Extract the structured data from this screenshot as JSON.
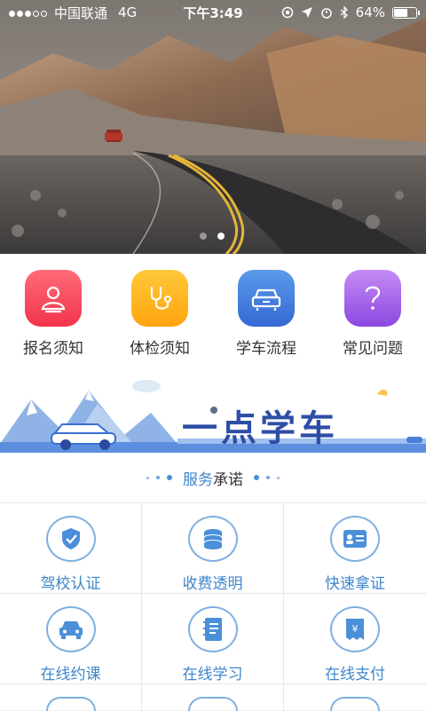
{
  "status_bar": {
    "carrier": "中国联通",
    "network": "4G",
    "time": "下午3:49",
    "battery": "64%",
    "battery_level": 0.64
  },
  "hero": {
    "slide_count": 2,
    "active_slide": 2
  },
  "quick_links": [
    {
      "label": "报名须知",
      "icon": "user-icon",
      "color_from": "#ff6b7a",
      "color_to": "#f2344b"
    },
    {
      "label": "体检须知",
      "icon": "stethoscope-icon",
      "color_from": "#ffc93a",
      "color_to": "#ffa40f"
    },
    {
      "label": "学车流程",
      "icon": "car-icon",
      "color_from": "#5a9bea",
      "color_to": "#3568d4"
    },
    {
      "label": "常见问题",
      "icon": "question-icon",
      "color_from": "#c58cf5",
      "color_to": "#8d47e0"
    }
  ],
  "banner": {
    "title": "一点学车"
  },
  "promise": {
    "title_blue": "服务",
    "title_dark": "承诺"
  },
  "services": [
    {
      "label": "驾校认证",
      "icon": "shield-check-icon"
    },
    {
      "label": "收费透明",
      "icon": "coins-icon"
    },
    {
      "label": "快速拿证",
      "icon": "id-card-icon"
    },
    {
      "label": "在线约课",
      "icon": "car-front-icon"
    },
    {
      "label": "在线学习",
      "icon": "notebook-icon"
    },
    {
      "label": "在线支付",
      "icon": "payment-receipt-icon"
    }
  ],
  "colors": {
    "accent_blue": "#3e86cc",
    "icon_blue": "#4a8fd8"
  }
}
